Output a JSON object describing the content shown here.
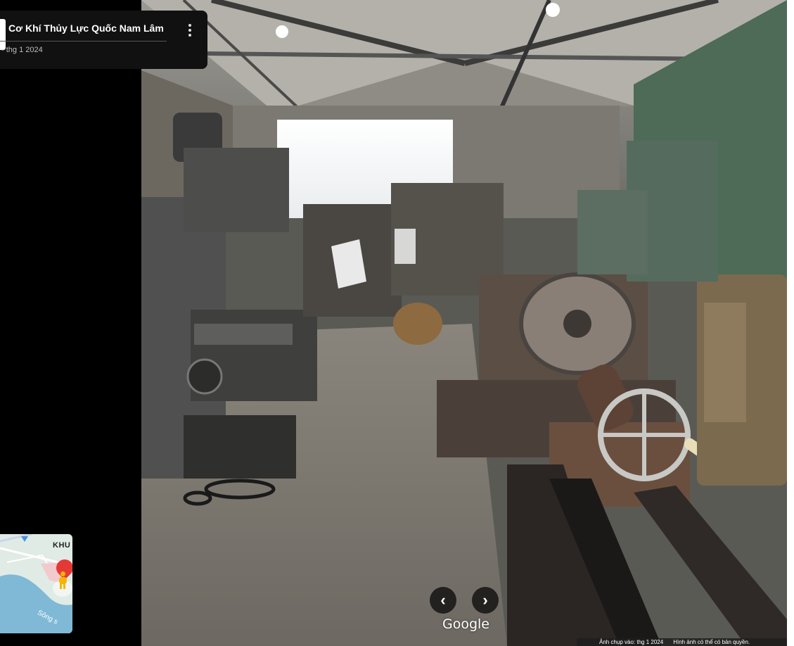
{
  "header": {
    "place_name": "Cơ Khí Thủy Lực Quốc Nam Lâm",
    "date_text": "- thg 1 2024",
    "more_icon": "more-vert-icon"
  },
  "mini_map": {
    "area_label": "KHU",
    "river_label": "Sông s",
    "pin_icon": "location-pin-icon",
    "pegman_icon": "pegman-icon"
  },
  "navigation": {
    "prev_glyph": "‹",
    "next_glyph": "›"
  },
  "branding": {
    "logo_text": "Google"
  },
  "attribution": {
    "capture_date": "Ảnh chụp vào: thg 1 2024",
    "copyright": "Hình ảnh có thể có bản quyền."
  },
  "colors": {
    "panel_bg": "#000000",
    "card_bg": "#111111",
    "map_pin": "#e53935",
    "pegman": "#f6b400"
  }
}
